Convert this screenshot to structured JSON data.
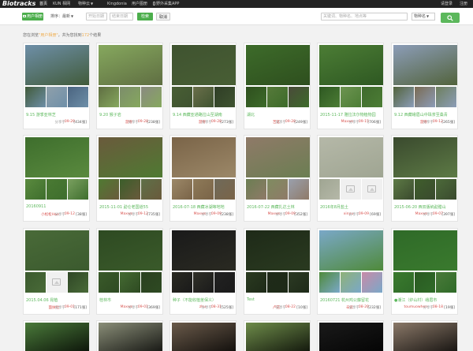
{
  "topnav": {
    "logo": "Biotracks",
    "items": [
      {
        "label": "首页",
        "active": true
      },
      {
        "label": "KUN 相网",
        "active": false
      },
      {
        "label": "物种云",
        "active": false,
        "caret": "▼"
      },
      {
        "label": "Kingdonia",
        "active": false
      },
      {
        "label": "用户图册",
        "active": false
      },
      {
        "label": "野外采集APP",
        "active": false
      }
    ],
    "login": "请登录",
    "register": "注册"
  },
  "filterbar": {
    "user_album_button": "用户相册",
    "sort_select": "排序：最新",
    "date_from_placeholder": "开始日期",
    "date_to_placeholder": "结束日期",
    "search_button": "检索",
    "cancel_button": "取消",
    "keyword_placeholder": "关键词、物种名、地点等",
    "scope_select": "物种名"
  },
  "stats": {
    "prefix": "您在浏览",
    "category": "\"用户相册\"",
    "middle": "，共为您找到",
    "count": "172",
    "suffix": "个结果"
  },
  "cards": [
    {
      "title": "9.15 游季亚林芝",
      "user": "",
      "shared": "分享于",
      "date": "· 09-29",
      "count": "[434张]",
      "colors": [
        "#6e8fa8",
        "#415b3a",
        "#8fa0ab",
        "#4a6480"
      ]
    },
    {
      "title": "9.20 猴子岩",
      "user": "游寺",
      "shared": "分享于",
      "date": "· 09-28",
      "count": "[238张]",
      "colors": [
        "#86a85e",
        "#5f6e42",
        "#7c8d6b",
        "#8a8a80"
      ]
    },
    {
      "title": "9.14 西藏亚通路拉山至湖南",
      "user": "游寺",
      "shared": "分享于",
      "date": "· 09-28",
      "count": "[273张]",
      "colors": [
        "#3f5330",
        "#485e34",
        "#6a6f4a",
        "#2f3e26"
      ]
    },
    {
      "title": "湖北",
      "user": "苦茗",
      "shared": "分享于",
      "date": "· 09-28",
      "count": "[249张]",
      "colors": [
        "#3d6b2a",
        "#2e4f1e",
        "#567a3a",
        "#4a4a3a"
      ]
    },
    {
      "title": "2015-11-17 雅拉法尔物植物园",
      "user": "Maxws",
      "shared": "分享于",
      "date": "· 09-15",
      "count": "[706张]",
      "colors": [
        "#4c7d35",
        "#2e5822",
        "#6d9451",
        "#3f6a2d"
      ]
    },
    {
      "title": "9.12 西藏峨眉山中珠茶至桑青",
      "user": "游寺",
      "shared": "分享于",
      "date": "· 09-12",
      "count": "[265张]",
      "colors": [
        "#8c9db8",
        "#52633c",
        "#7a6a52",
        "#6d7f5d"
      ]
    },
    {
      "title": "20160911",
      "user": "小松松Hws",
      "shared": "分享于",
      "date": "· 09-12",
      "count": "[38张]",
      "colors": [
        "#3e6e2d",
        "#5a8a3e",
        "#4a7a33",
        "#7aa060"
      ]
    },
    {
      "title": "2015-11-01 勐仑老国道55",
      "user": "Maxws",
      "shared": "分享于",
      "date": "· 09-12",
      "count": "[735张]",
      "colors": [
        "#6a5a3c",
        "#4f7a32",
        "#3b5e2a",
        "#5e7048"
      ]
    },
    {
      "title": "2016-07-18 西藏冰湖等地地",
      "user": "Maxws",
      "shared": "分享于",
      "date": "· 09-09",
      "count": "[238张]",
      "colors": [
        "#7a6448",
        "#9c8868",
        "#8e7a58",
        "#6f6a5a"
      ]
    },
    {
      "title": "2016-07-22 西藏扎达土林",
      "user": "Maxws",
      "shared": "分享于",
      "date": "· 09-09",
      "count": "[352张]",
      "colors": [
        "#8f7a68",
        "#6b7e52",
        "#7f8c60",
        "#9aa0ad"
      ]
    },
    {
      "title": "2016年8月盐土",
      "user": "xinyu",
      "shared": "分享于",
      "date": "· 09-09",
      "count": "[69张]",
      "colors": [
        "#b5b8a8",
        "#9fa592",
        "#e8e8e8",
        "#e8e8e8"
      ]
    },
    {
      "title": "2015-06-20 西双版纳勐腊山",
      "user": "Maxws",
      "shared": "分享于",
      "date": "· 09-07",
      "count": "[397张]",
      "colors": [
        "#3a4a2e",
        "#5d7a45",
        "#3f5e2c",
        "#4c6a3a"
      ]
    },
    {
      "title": "2015.04.06 昆植",
      "user": "面扶拉",
      "shared": "分享于",
      "date": "· 09-01",
      "count": "[171张]",
      "colors": [
        "#496a38",
        "#3b5a2e",
        "#dadada",
        "#2f4726"
      ]
    },
    {
      "title": "桂林市",
      "user": "Maxws",
      "shared": "分享于",
      "date": "· 09-01",
      "count": "[369张]",
      "colors": [
        "#2e4a22",
        "#3a5a2a",
        "#446a32",
        "#2a4020"
      ]
    },
    {
      "title": "种子（不能收植茎保义）",
      "user": "zhu",
      "shared": "分享于",
      "date": "· 08-31",
      "count": "[525张]",
      "colors": [
        "#1a1a1a",
        "#2a2a22",
        "#303028",
        "#222"
      ]
    },
    {
      "title": "Test",
      "user": "卢花",
      "shared": "分享于",
      "date": "· 08-22",
      "count": "[10张]",
      "colors": [
        "#1e2a18",
        "#2a3a20",
        "#1f2a19",
        "#2c3a24"
      ]
    },
    {
      "title": "20160721 杭州鸡公藤留花",
      "user": "辛云",
      "shared": "分享于",
      "date": "· 08-20",
      "count": "[232张]",
      "colors": [
        "#7aa8c8",
        "#4f8a3a",
        "#8fb278",
        "#c88aa8"
      ]
    },
    {
      "title": "●潮江（炉山村）峨眉市",
      "user": "toumuowhen",
      "shared": "分享于",
      "date": "· 08-18",
      "count": "[19张]",
      "colors": [
        "#2f6a28",
        "#3a7a2e",
        "#2a5a22",
        "#4a7a3a"
      ]
    },
    {
      "title": "",
      "user": "",
      "shared": "",
      "date": "",
      "count": "",
      "colors": [
        "#4a7a3a",
        "#000",
        "#000",
        "#000"
      ]
    },
    {
      "title": "",
      "user": "",
      "shared": "",
      "date": "",
      "count": "",
      "colors": [
        "#8a8e78",
        "#000",
        "#000",
        "#000"
      ]
    },
    {
      "title": "",
      "user": "",
      "shared": "",
      "date": "",
      "count": "",
      "colors": [
        "#6a5a4a",
        "#000",
        "#000",
        "#000"
      ]
    },
    {
      "title": "",
      "user": "",
      "shared": "",
      "date": "",
      "count": "",
      "colors": [
        "#6e8c4a",
        "#000",
        "#000",
        "#000"
      ]
    },
    {
      "title": "",
      "user": "",
      "shared": "",
      "date": "",
      "count": "",
      "colors": [
        "#1a1a1a",
        "#000",
        "#000",
        "#000"
      ]
    },
    {
      "title": "",
      "user": "",
      "shared": "",
      "date": "",
      "count": "",
      "colors": [
        "#8a7868",
        "#000",
        "#000",
        "#000"
      ]
    }
  ]
}
